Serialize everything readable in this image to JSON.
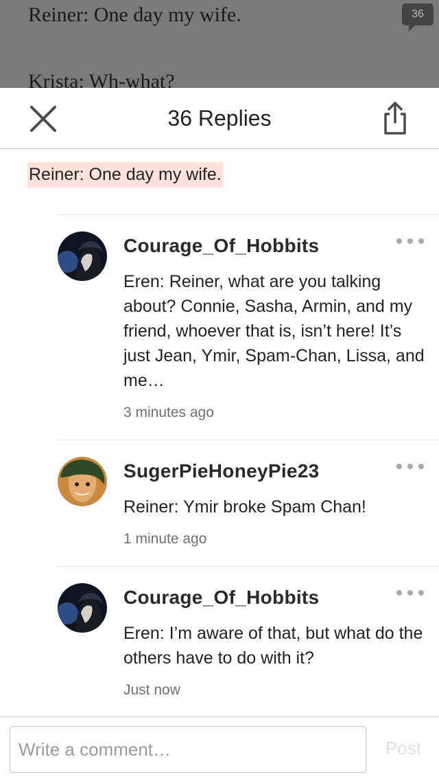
{
  "story": {
    "line1": "Reiner: One day my wife.",
    "line2": "Krista: Wh-what?",
    "comment_count": "36"
  },
  "header": {
    "title": "36 Replies"
  },
  "quote": "Reiner: One day my wife.",
  "comments": [
    {
      "username": "Courage_Of_Hobbits",
      "body": "Eren: Reiner, what are you talking about? Connie, Sasha, Armin, and my friend, whoever that is, isn’t here! It’s just Jean, Ymir, Spam-Chan, Lissa, and me…",
      "time": "3 minutes ago"
    },
    {
      "username": "SugerPieHoneyPie23",
      "body": "Reiner: Ymir broke Spam Chan!",
      "time": "1 minute ago"
    },
    {
      "username": "Courage_Of_Hobbits",
      "body": "Eren: I’m aware of that, but what do the others have to do with it?",
      "time": "Just now"
    }
  ],
  "footer": {
    "placeholder": "Write a comment…",
    "post_label": "Post"
  }
}
